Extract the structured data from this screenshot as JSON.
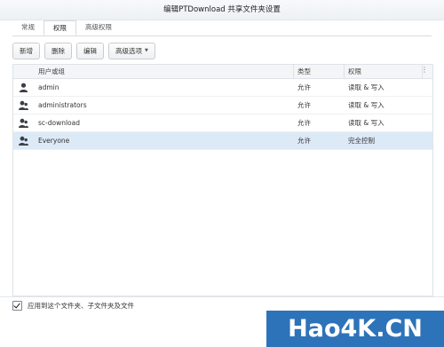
{
  "window": {
    "title": "编辑PTDownload 共享文件夹设置"
  },
  "tabs": [
    {
      "label": "常规",
      "active": false
    },
    {
      "label": "权限",
      "active": true
    },
    {
      "label": "高级权限",
      "active": false
    }
  ],
  "toolbar": {
    "add": "新增",
    "delete": "删除",
    "edit": "编辑",
    "advanced": "高级选项"
  },
  "table": {
    "columns": [
      "用户或组",
      "类型",
      "权限"
    ],
    "rows": [
      {
        "icon": "single-user-icon",
        "name": "admin",
        "type": "允许",
        "perm": "读取 & 写入",
        "selected": false
      },
      {
        "icon": "group-users-icon",
        "name": "administrators",
        "type": "允许",
        "perm": "读取 & 写入",
        "selected": false
      },
      {
        "icon": "group-users-icon",
        "name": "sc-download",
        "type": "允许",
        "perm": "读取 & 写入",
        "selected": false
      },
      {
        "icon": "group-users-icon",
        "name": "Everyone",
        "type": "允许",
        "perm": "完全控制",
        "selected": true
      }
    ]
  },
  "footer": {
    "apply_label": "应用到这个文件夹、子文件夹及文件",
    "apply_checked": true
  },
  "watermark": {
    "part1": "Hao4K",
    "part2": ".CN"
  },
  "colors": {
    "selected_row": "#dce9f7",
    "watermark_bg": "#2d73b9"
  }
}
